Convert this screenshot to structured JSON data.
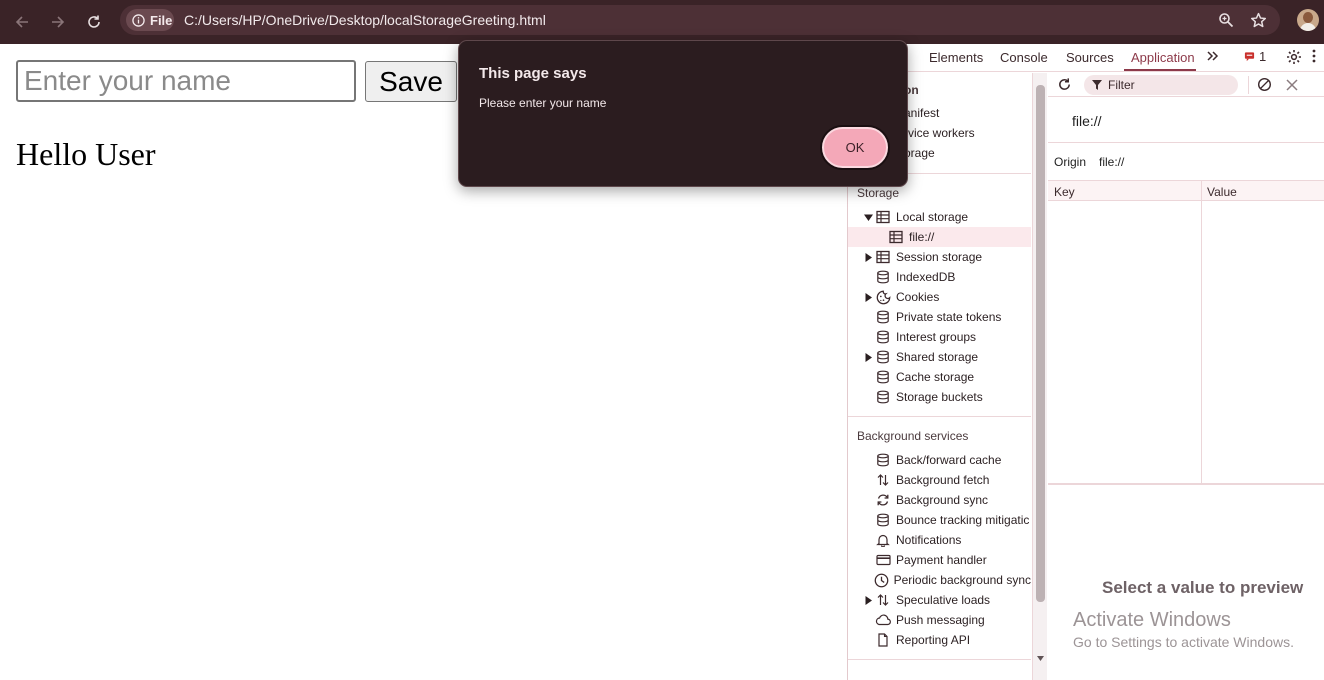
{
  "browser": {
    "site_chip": "File",
    "url": "C:/Users/HP/OneDrive/Desktop/localStorageGreeting.html"
  },
  "page": {
    "name_placeholder": "Enter your name",
    "save_label": "Save",
    "greeting": "Hello User"
  },
  "dialog": {
    "title": "This page says",
    "message": "Please enter your name",
    "ok_label": "OK"
  },
  "devtools": {
    "tabs": [
      "Elements",
      "Console",
      "Sources",
      "Application"
    ],
    "active_tab": "Application",
    "issues_count": "1",
    "application_items": [
      "Manifest",
      "Service workers",
      "Storage"
    ],
    "application_items_visible": [
      "anifest",
      "rvice workers",
      "orage"
    ],
    "application_head_visible": "on",
    "storage_head": "Storage",
    "storage_items": [
      {
        "label": "Local storage",
        "icon": "table-icon",
        "arrow": "expanded"
      },
      {
        "label": "file://",
        "icon": "table-icon",
        "arrow": "none",
        "child": true,
        "selected": true
      },
      {
        "label": "Session storage",
        "icon": "table-icon",
        "arrow": "collapsed"
      },
      {
        "label": "IndexedDB",
        "icon": "database-icon",
        "arrow": "none"
      },
      {
        "label": "Cookies",
        "icon": "cookie-icon",
        "arrow": "collapsed"
      },
      {
        "label": "Private state tokens",
        "icon": "database-icon",
        "arrow": "none"
      },
      {
        "label": "Interest groups",
        "icon": "database-icon",
        "arrow": "none"
      },
      {
        "label": "Shared storage",
        "icon": "database-icon",
        "arrow": "collapsed"
      },
      {
        "label": "Cache storage",
        "icon": "database-icon",
        "arrow": "none"
      },
      {
        "label": "Storage buckets",
        "icon": "database-icon",
        "arrow": "none"
      }
    ],
    "background_head": "Background services",
    "background_items": [
      {
        "label": "Back/forward cache",
        "icon": "database-icon",
        "arrow": "none"
      },
      {
        "label": "Background fetch",
        "icon": "updown-arrows-icon",
        "arrow": "none"
      },
      {
        "label": "Background sync",
        "icon": "sync-icon",
        "arrow": "none"
      },
      {
        "label": "Bounce tracking mitigatic",
        "icon": "database-icon",
        "arrow": "none"
      },
      {
        "label": "Notifications",
        "icon": "bell-icon",
        "arrow": "none"
      },
      {
        "label": "Payment handler",
        "icon": "card-icon",
        "arrow": "none"
      },
      {
        "label": "Periodic background sync",
        "icon": "clock-icon",
        "arrow": "none"
      },
      {
        "label": "Speculative loads",
        "icon": "updown-arrows-icon",
        "arrow": "collapsed"
      },
      {
        "label": "Push messaging",
        "icon": "cloud-icon",
        "arrow": "none"
      },
      {
        "label": "Reporting API",
        "icon": "file-icon",
        "arrow": "none"
      }
    ],
    "filter_placeholder": "Filter",
    "origin_title": "file://",
    "origin_label": "Origin",
    "origin_value": "file://",
    "columns": [
      "Key",
      "Value"
    ],
    "preview_text": "Select a value to preview"
  },
  "watermark": {
    "line1": "Activate Windows",
    "line2": "Go to Settings to activate Windows."
  },
  "colors": {
    "toolbar_bg": "#3a2327",
    "dialog_bg": "#2b1c1f",
    "ok_button": "#f4a8b8",
    "accent": "#8d3a4a"
  }
}
